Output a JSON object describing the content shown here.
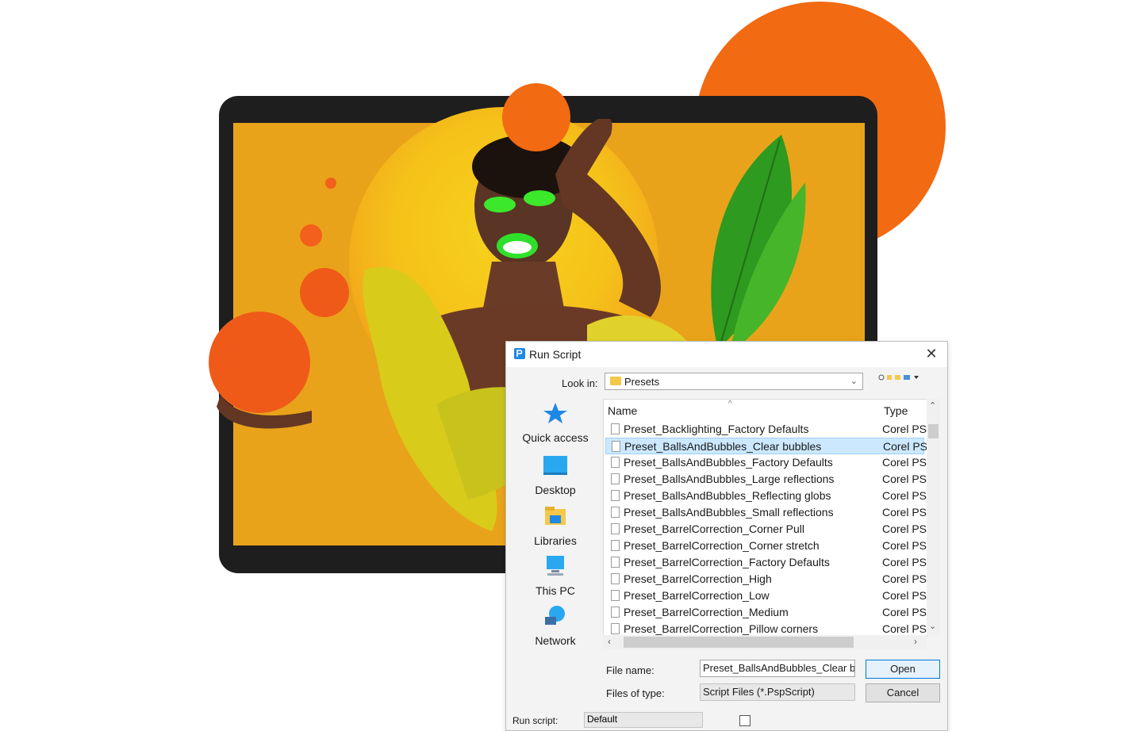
{
  "dialog": {
    "title": "Run Script",
    "close_glyph": "✕",
    "look_in_label": "Look in:",
    "look_in_value": "Presets",
    "file_name_label": "File name:",
    "file_name_value": "Preset_BallsAndBubbles_Clear bubbles",
    "files_of_type_label": "Files of type:",
    "files_of_type_value": "Script Files (*.PspScript)",
    "open_label": "Open",
    "cancel_label": "Cancel",
    "run_script_label": "Run script:",
    "run_script_value": "Default"
  },
  "places": [
    {
      "label": "Quick access",
      "icon": "star-icon"
    },
    {
      "label": "Desktop",
      "icon": "desktop-icon"
    },
    {
      "label": "Libraries",
      "icon": "libraries-icon"
    },
    {
      "label": "This PC",
      "icon": "computer-icon"
    },
    {
      "label": "Network",
      "icon": "network-icon"
    }
  ],
  "list": {
    "col_name": "Name",
    "col_type": "Type",
    "rows": [
      {
        "name": "Preset_Backlighting_Factory Defaults",
        "type": "Corel PS",
        "selected": false
      },
      {
        "name": "Preset_BallsAndBubbles_Clear bubbles",
        "type": "Corel PS",
        "selected": true
      },
      {
        "name": "Preset_BallsAndBubbles_Factory Defaults",
        "type": "Corel PS",
        "selected": false
      },
      {
        "name": "Preset_BallsAndBubbles_Large reflections",
        "type": "Corel PS",
        "selected": false
      },
      {
        "name": "Preset_BallsAndBubbles_Reflecting globs",
        "type": "Corel PS",
        "selected": false
      },
      {
        "name": "Preset_BallsAndBubbles_Small reflections",
        "type": "Corel PS",
        "selected": false
      },
      {
        "name": "Preset_BarrelCorrection_Corner Pull",
        "type": "Corel PS",
        "selected": false
      },
      {
        "name": "Preset_BarrelCorrection_Corner stretch",
        "type": "Corel PS",
        "selected": false
      },
      {
        "name": "Preset_BarrelCorrection_Factory Defaults",
        "type": "Corel PS",
        "selected": false
      },
      {
        "name": "Preset_BarrelCorrection_High",
        "type": "Corel PS",
        "selected": false
      },
      {
        "name": "Preset_BarrelCorrection_Low",
        "type": "Corel PS",
        "selected": false
      },
      {
        "name": "Preset_BarrelCorrection_Medium",
        "type": "Corel PS",
        "selected": false
      },
      {
        "name": "Preset_BarrelCorrection_Pillow corners",
        "type": "Corel PS",
        "selected": false
      }
    ]
  },
  "colors": {
    "accent_orange": "#f26a12",
    "selection": "#cce8ff",
    "open_border": "#0078d7"
  }
}
